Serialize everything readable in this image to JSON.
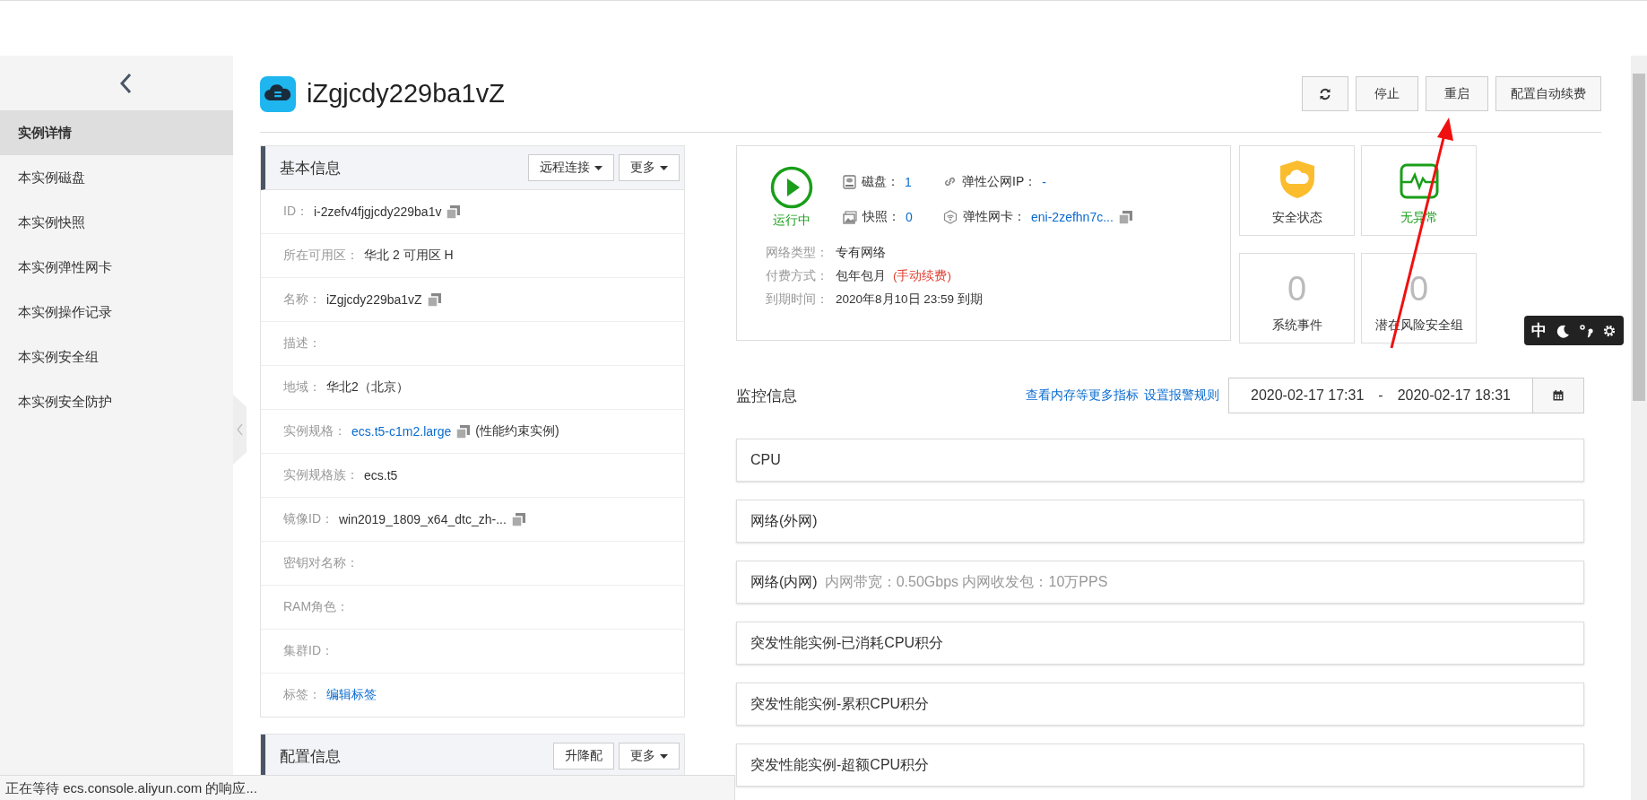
{
  "sidebar": {
    "items": [
      {
        "label": "实例详情",
        "selected": true
      },
      {
        "label": "本实例磁盘",
        "selected": false
      },
      {
        "label": "本实例快照",
        "selected": false
      },
      {
        "label": "本实例弹性网卡",
        "selected": false
      },
      {
        "label": "本实例操作记录",
        "selected": false
      },
      {
        "label": "本实例安全组",
        "selected": false
      },
      {
        "label": "本实例安全防护",
        "selected": false
      }
    ]
  },
  "header": {
    "title": "iZgjcdy229ba1vZ",
    "actions": [
      {
        "kind": "refresh"
      },
      {
        "kind": "text",
        "label": "停止"
      },
      {
        "kind": "text",
        "label": "重启"
      },
      {
        "kind": "text",
        "label": "配置自动续费"
      }
    ]
  },
  "basic_info": {
    "title": "基本信息",
    "buttons": [
      {
        "label": "远程连接",
        "dropdown": true
      },
      {
        "label": "更多",
        "dropdown": true
      }
    ],
    "fields": [
      {
        "label": "ID：",
        "value": "i-2zefv4fjgjcdy229ba1v",
        "copy": true
      },
      {
        "label": "所在可用区：",
        "value": "华北 2 可用区 H"
      },
      {
        "label": "名称：",
        "value": "iZgjcdy229ba1vZ",
        "copy": true
      },
      {
        "label": "描述："
      },
      {
        "label": "地域：",
        "value": "华北2（北京）"
      },
      {
        "label": "实例规格：",
        "value": "ecs.t5-c1m2.large",
        "link": true,
        "copy": true,
        "suffix": "(性能约束实例)"
      },
      {
        "label": "实例规格族：",
        "value": "ecs.t5"
      },
      {
        "label": "镜像ID：",
        "value": "win2019_1809_x64_dtc_zh-...",
        "copy": true
      },
      {
        "label": "密钥对名称："
      },
      {
        "label": "RAM角色："
      },
      {
        "label": "集群ID："
      },
      {
        "label": "标签：",
        "value": "编辑标签",
        "link": true
      }
    ]
  },
  "config_info": {
    "title": "配置信息",
    "buttons": [
      {
        "label": "升降配",
        "dropdown": false
      },
      {
        "label": "更多",
        "dropdown": true
      }
    ]
  },
  "status": {
    "state": "运行中",
    "resources": [
      {
        "kind": "disk",
        "label": "磁盘：",
        "value": "1"
      },
      {
        "kind": "eip",
        "label": "弹性公网IP：",
        "value": "-"
      },
      {
        "kind": "snapshot",
        "label": "快照：",
        "value": "0"
      },
      {
        "kind": "eni",
        "label": "弹性网卡：",
        "value": "eni-2zefhn7c...",
        "copy": true
      }
    ],
    "details": [
      {
        "label": "网络类型：",
        "value": "专有网络"
      },
      {
        "label": "付费方式：",
        "value": "包年包月",
        "note": "(手动续费)"
      },
      {
        "label": "到期时间：",
        "value": "2020年8月10日 23:59 到期"
      }
    ]
  },
  "tiles": [
    {
      "kind": "security",
      "label": "安全状态"
    },
    {
      "kind": "health",
      "label": "无异常"
    },
    {
      "kind": "count",
      "value": "0",
      "label": "系统事件"
    },
    {
      "kind": "count",
      "value": "0",
      "label": "潜在风险安全组"
    }
  ],
  "monitor": {
    "title": "监控信息",
    "links": [
      "查看内存等更多指标",
      "设置报警规则"
    ],
    "start": "2020-02-17 17:31",
    "separator": "-",
    "end": "2020-02-17 18:31",
    "panels": [
      {
        "title": "CPU"
      },
      {
        "title": "网络(外网)"
      },
      {
        "title": "网络(内网)",
        "note": "内网带宽：0.50Gbps 内网收发包：10万PPS"
      },
      {
        "title": "突发性能实例-已消耗CPU积分"
      },
      {
        "title": "突发性能实例-累积CPU积分"
      },
      {
        "title": "突发性能实例-超额CPU积分"
      }
    ]
  },
  "ime": {
    "mode": "中"
  },
  "status_bar": "正在等待 ecs.console.aliyun.com 的响应..."
}
